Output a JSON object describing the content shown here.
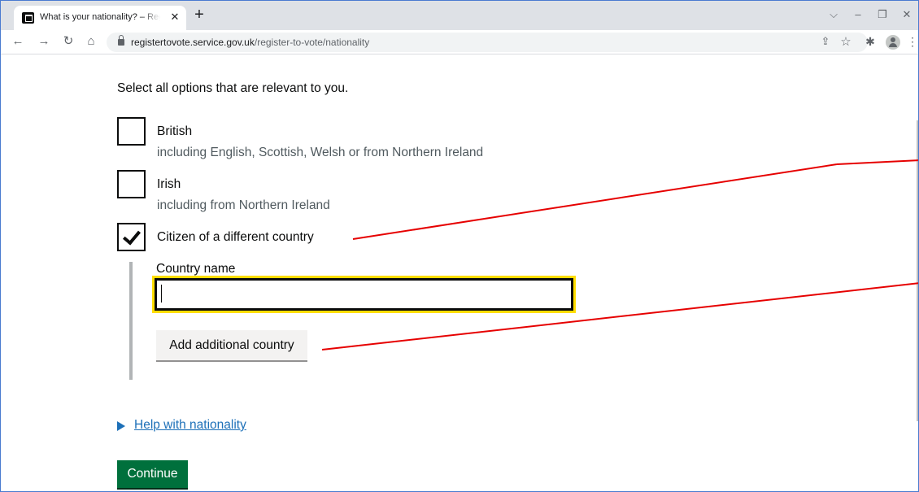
{
  "browser": {
    "tab_title": "What is your nationality? – Register to vote",
    "tab_close": "✕",
    "new_tab": "+",
    "url_domain": "registertovote.service.gov.uk",
    "url_path": "/register-to-vote/nationality"
  },
  "form": {
    "hint": "Select all options that are relevant to you.",
    "options": [
      {
        "label": "British",
        "hint": "including English, Scottish, Welsh or from Northern Ireland",
        "checked": false
      },
      {
        "label": "Irish",
        "hint": "including from Northern Ireland",
        "checked": false
      },
      {
        "label": "Citizen of a different country",
        "hint": "",
        "checked": true
      }
    ],
    "country_label": "Country name",
    "country_value": "",
    "add_country_label": "Add additional country",
    "details_summary": "Help with nationality",
    "continue_label": "Continue"
  },
  "colors": {
    "focus": "#ffdd00",
    "link": "#1d70b8",
    "primary_button": "#00703c",
    "annotation": "#e60000"
  }
}
